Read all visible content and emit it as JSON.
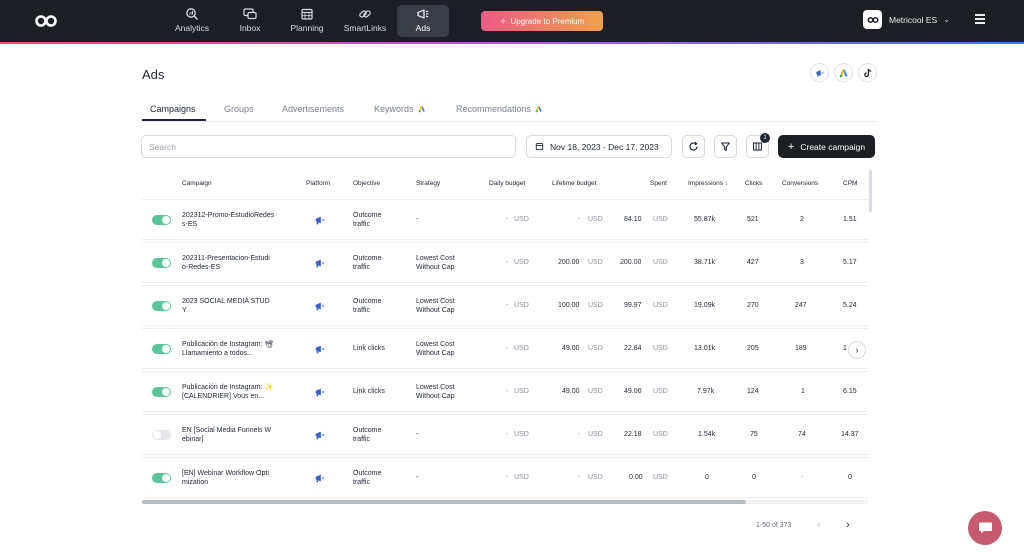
{
  "nav": {
    "items": [
      {
        "label": "Analytics",
        "icon": "analytics-icon"
      },
      {
        "label": "Inbox",
        "icon": "inbox-icon"
      },
      {
        "label": "Planning",
        "icon": "calendar-icon"
      },
      {
        "label": "SmartLinks",
        "icon": "link-icon"
      },
      {
        "label": "Ads",
        "icon": "megaphone-icon",
        "active": true
      }
    ],
    "upgrade_label": "Upgrade to Premium",
    "account_name": "Metricool ES"
  },
  "page": {
    "title": "Ads",
    "platforms": [
      "meta-ads-icon",
      "google-ads-icon",
      "tiktok-icon"
    ]
  },
  "tabs": [
    {
      "label": "Campaigns",
      "active": true
    },
    {
      "label": "Groups"
    },
    {
      "label": "Advertisements"
    },
    {
      "label": "Keywords",
      "icon": "google-ads-icon"
    },
    {
      "label": "Recommendations",
      "icon": "google-ads-icon"
    }
  ],
  "toolbar": {
    "search_placeholder": "Search",
    "date_range": "Nov 18, 2023 - Dec 17, 2023",
    "columns_badge": "1",
    "create_label": "Create campaign"
  },
  "table": {
    "headers": {
      "campaign": "Campaign",
      "platform": "Platform",
      "objective": "Objective",
      "strategy": "Strategy",
      "daily_budget": "Daily budget",
      "lifetime_budget": "Lifetime budget",
      "spent": "Spent",
      "impressions": "Impressions",
      "clicks": "Clicks",
      "conversions": "Conversions",
      "cpm": "CPM"
    },
    "rows": [
      {
        "active": true,
        "campaign1": "202312-Promo-EstudioRedes",
        "campaign2": "s-ES",
        "objective1": "Outcome",
        "objective2": "traffic",
        "strategy1": "-",
        "strategy2": "",
        "daily": "-",
        "daily_cur": "USD",
        "lifetime": "-",
        "lifetime_cur": "USD",
        "spent": "84.10",
        "spent_cur": "USD",
        "impressions": "55.87k",
        "clicks": "521",
        "conversions": "2",
        "cpm": "1.51"
      },
      {
        "active": true,
        "campaign1": "202311-Presentacion-Estudi",
        "campaign2": "o-Redes-ES",
        "objective1": "Outcome",
        "objective2": "traffic",
        "strategy1": "Lowest Cost",
        "strategy2": "Without Cap",
        "daily": "-",
        "daily_cur": "USD",
        "lifetime": "200.00",
        "lifetime_cur": "USD",
        "spent": "200.00",
        "spent_cur": "USD",
        "impressions": "38.71k",
        "clicks": "427",
        "conversions": "3",
        "cpm": "5.17"
      },
      {
        "active": true,
        "campaign1": "2023 SOCIAL MEDIA STUD",
        "campaign2": "Y",
        "objective1": "Outcome",
        "objective2": "traffic",
        "strategy1": "Lowest Cost",
        "strategy2": "Without Cap",
        "daily": "-",
        "daily_cur": "USD",
        "lifetime": "100.00",
        "lifetime_cur": "USD",
        "spent": "99.97",
        "spent_cur": "USD",
        "impressions": "19.09k",
        "clicks": "270",
        "conversions": "247",
        "cpm": "5.24"
      },
      {
        "active": true,
        "campaign1": "Publicación de Instagram: 📽",
        "campaign2": "Llamamiento a todos...",
        "objective1": "Link clicks",
        "objective2": "",
        "strategy1": "Lowest Cost",
        "strategy2": "Without Cap",
        "daily": "-",
        "daily_cur": "USD",
        "lifetime": "49.00",
        "lifetime_cur": "USD",
        "spent": "22.84",
        "spent_cur": "USD",
        "impressions": "13.01k",
        "clicks": "205",
        "conversions": "189",
        "cpm": "1"
      },
      {
        "active": true,
        "campaign1": "Publicación de Instagram: ✨",
        "campaign2": "[CALENDRIER] Vous en...",
        "objective1": "Link clicks",
        "objective2": "",
        "strategy1": "Lowest Cost",
        "strategy2": "Without Cap",
        "daily": "-",
        "daily_cur": "USD",
        "lifetime": "49.00",
        "lifetime_cur": "USD",
        "spent": "49.00",
        "spent_cur": "USD",
        "impressions": "7.97k",
        "clicks": "124",
        "conversions": "1",
        "cpm": "6.15"
      },
      {
        "active": false,
        "campaign1": "EN [Social Media Funnels W",
        "campaign2": "ebinar]",
        "objective1": "Outcome",
        "objective2": "traffic",
        "strategy1": "-",
        "strategy2": "",
        "daily": "-",
        "daily_cur": "USD",
        "lifetime": "-",
        "lifetime_cur": "USD",
        "spent": "22.18",
        "spent_cur": "USD",
        "impressions": "1.54k",
        "clicks": "75",
        "conversions": "74",
        "cpm": "14.37"
      },
      {
        "active": true,
        "campaign1": "[EN] Webinar Workflow Opti",
        "campaign2": "mization",
        "objective1": "Outcome",
        "objective2": "traffic",
        "strategy1": "-",
        "strategy2": "",
        "daily": "-",
        "daily_cur": "USD",
        "lifetime": "-",
        "lifetime_cur": "USD",
        "spent": "0.00",
        "spent_cur": "USD",
        "impressions": "0",
        "clicks": "0",
        "conversions": "-",
        "cpm": "0"
      }
    ]
  },
  "pagination": {
    "range": "1-50 of 373"
  },
  "colors": {
    "toggle_on": "#5cc49a",
    "create_bg": "#1c1f24",
    "meta_blue": "#3b5fc7"
  }
}
